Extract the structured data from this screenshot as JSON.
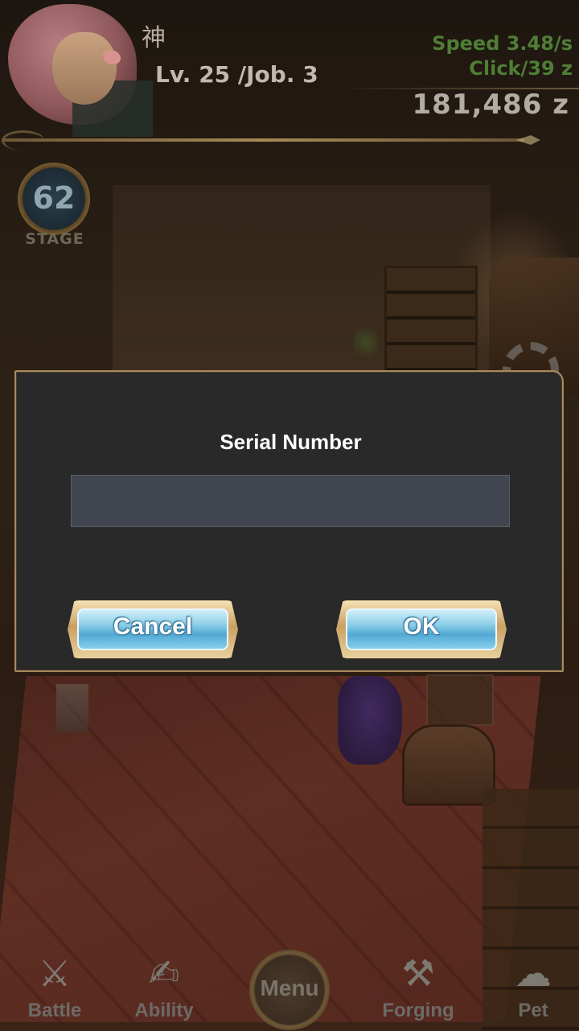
{
  "header": {
    "player_name": "神",
    "level_job": "Lv. 25 /Job. 3",
    "speed": "Speed 3.48/s",
    "click": "Click/39 z",
    "zeny": "181,486 z"
  },
  "stage": {
    "number": "62",
    "label": "STAGE"
  },
  "dialog": {
    "title": "Serial Number",
    "input_value": "",
    "cancel_label": "Cancel",
    "ok_label": "OK"
  },
  "bottom_nav": {
    "items": [
      {
        "label": "Battle",
        "icon": "crossed-swords-icon"
      },
      {
        "label": "Ability",
        "icon": "scroll-icon"
      },
      {
        "label": "Menu",
        "icon": "menu-disc-icon"
      },
      {
        "label": "Forging",
        "icon": "hammer-icon"
      },
      {
        "label": "Pet",
        "icon": "pet-icon"
      }
    ]
  },
  "colors": {
    "speed_green": "#4f7e36",
    "dialog_bg": "#292929",
    "dialog_border": "#a88a5c",
    "input_bg": "#404550",
    "button_blue": "#52a9d3"
  }
}
